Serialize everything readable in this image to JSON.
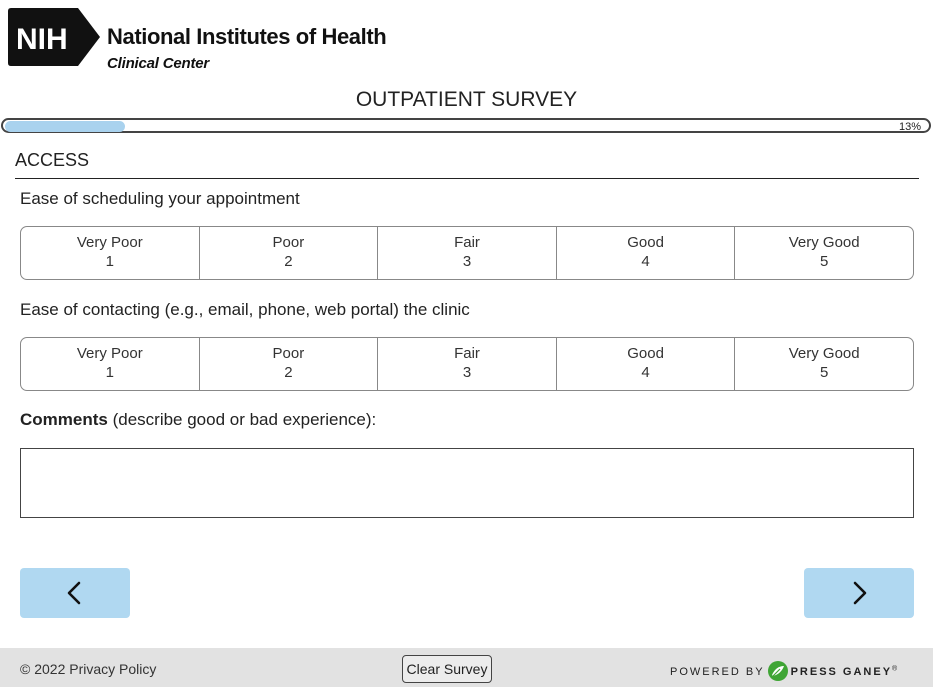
{
  "header": {
    "logo_text": "NIH",
    "org_name": "National Institutes of Health",
    "org_sub": "Clinical Center"
  },
  "survey": {
    "title": "OUTPATIENT SURVEY",
    "progress_percent": 13,
    "progress_text": "13%"
  },
  "section": {
    "title": "ACCESS"
  },
  "questions": [
    {
      "label": "Ease of scheduling your appointment",
      "options": [
        {
          "label": "Very Poor",
          "value": "1"
        },
        {
          "label": "Poor",
          "value": "2"
        },
        {
          "label": "Fair",
          "value": "3"
        },
        {
          "label": "Good",
          "value": "4"
        },
        {
          "label": "Very Good",
          "value": "5"
        }
      ]
    },
    {
      "label": "Ease of contacting (e.g., email, phone, web portal) the clinic",
      "options": [
        {
          "label": "Very Poor",
          "value": "1"
        },
        {
          "label": "Poor",
          "value": "2"
        },
        {
          "label": "Fair",
          "value": "3"
        },
        {
          "label": "Good",
          "value": "4"
        },
        {
          "label": "Very Good",
          "value": "5"
        }
      ]
    }
  ],
  "comments": {
    "label_bold": "Comments",
    "label_rest": " (describe good or bad experience):",
    "value": ""
  },
  "navigation": {
    "prev_icon": "chevron-left-icon",
    "next_icon": "chevron-right-icon"
  },
  "footer": {
    "copyright": "© 2022 Privacy Policy",
    "clear_label": "Clear Survey",
    "powered_by": "POWERED BY",
    "brand": "PRESS GANEY",
    "brand_mark": "®",
    "brand_icon": "press-ganey-leaf-icon"
  },
  "colors": {
    "button_bg": "#b0d8f1",
    "progress_fill": "#a9d2ee",
    "brand_green": "#3fa535"
  }
}
